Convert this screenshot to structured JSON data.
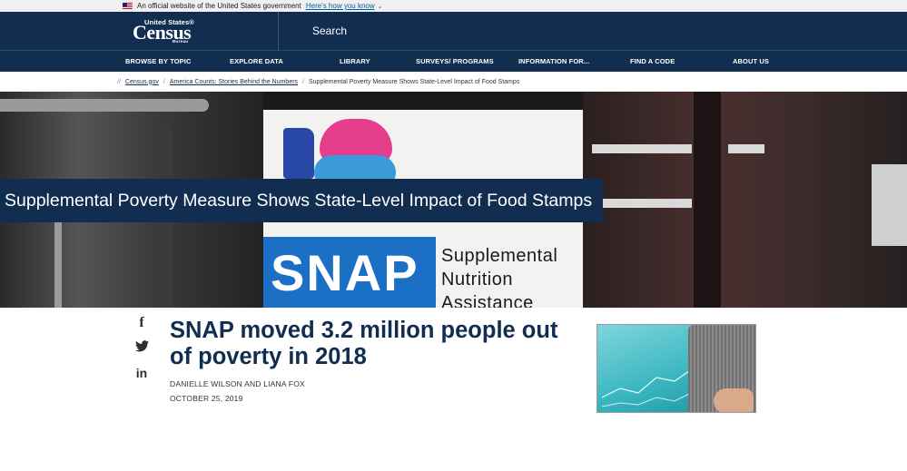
{
  "gov_banner": {
    "text": "An official website of the United States government",
    "link": "Here's how you know",
    "chevron": "⌄"
  },
  "header": {
    "logo_top": "United States®",
    "logo_main": "Census",
    "logo_sub": "Bureau",
    "search_label": "Search"
  },
  "nav": {
    "items": [
      "BROWSE BY TOPIC",
      "EXPLORE DATA",
      "LIBRARY",
      "SURVEYS/ PROGRAMS",
      "INFORMATION FOR...",
      "FIND A CODE",
      "ABOUT US"
    ]
  },
  "breadcrumb": {
    "items": [
      "Census.gov",
      "America Counts: Stories Behind the Numbers",
      "Supplemental Poverty Measure Shows State-Level Impact of Food Stamps"
    ]
  },
  "hero": {
    "title": "Supplemental Poverty Measure Shows State-Level Impact of Food Stamps",
    "bag_main": "SNAP",
    "bag_sub_1": "Supplemental",
    "bag_sub_2": "Nutrition",
    "bag_sub_3": "Assistance"
  },
  "share": {
    "facebook": "f",
    "twitter": "🐦",
    "linkedin": "in"
  },
  "article": {
    "title": "SNAP moved 3.2 million people out of poverty in 2018",
    "authors": "DANIELLE WILSON AND LIANA FOX",
    "date": "OCTOBER 25, 2019"
  },
  "colors": {
    "navy": "#112e51",
    "link_blue": "#005ea2"
  }
}
